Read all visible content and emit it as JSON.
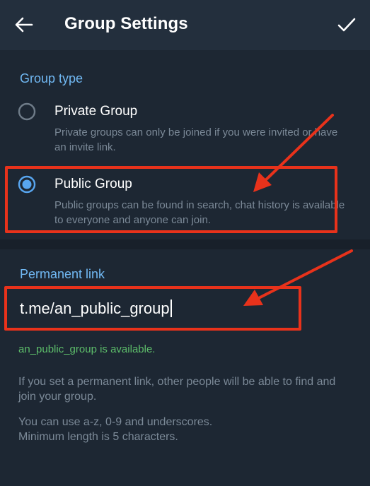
{
  "header": {
    "title": "Group Settings",
    "back_icon": "arrow-left-icon",
    "done_icon": "checkmark-icon"
  },
  "group_type": {
    "section_title": "Group type",
    "options": [
      {
        "label": "Private Group",
        "description": "Private groups can only be joined if you were invited or have an invite link.",
        "selected": false
      },
      {
        "label": "Public Group",
        "description": "Public groups can be found in search, chat history is available to everyone and anyone can join.",
        "selected": true
      }
    ]
  },
  "permanent_link": {
    "section_title": "Permanent link",
    "value": "t.me/an_public_group",
    "status": "an_public_group is available.",
    "info_1": "If you set a permanent link, other people will be able to find and join your group.",
    "info_2_line1": "You can use a-z, 0-9 and underscores.",
    "info_2_line2": "Minimum length is 5 characters."
  },
  "colors": {
    "background": "#1d2733",
    "header": "#232f3d",
    "accent": "#71b9f4",
    "radio_selected": "#58a6f0",
    "available": "#5dbd6a",
    "annotation": "#e8321b"
  }
}
